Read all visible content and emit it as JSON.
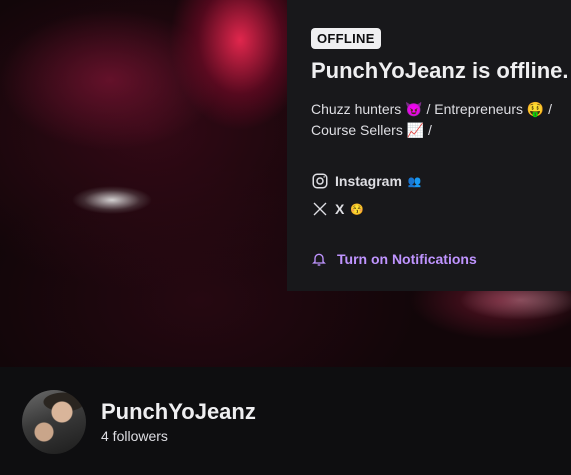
{
  "offline_card": {
    "badge": "OFFLINE",
    "title": "PunchYoJeanz is offline.",
    "bio": "Chuzz hunters 😈 / Entrepreneurs 🤑 / Course Sellers 📈 /",
    "socials": [
      {
        "icon": "instagram-icon",
        "label": "Instagram",
        "emoji": "👥"
      },
      {
        "icon": "x-logo-icon",
        "label": "X",
        "emoji": "😚"
      }
    ],
    "notify_label": "Turn on Notifications"
  },
  "channel": {
    "name": "PunchYoJeanz",
    "followers": "4 followers"
  },
  "colors": {
    "accent": "#bf94ff",
    "background": "#0e0e10",
    "card": "#18181b"
  }
}
